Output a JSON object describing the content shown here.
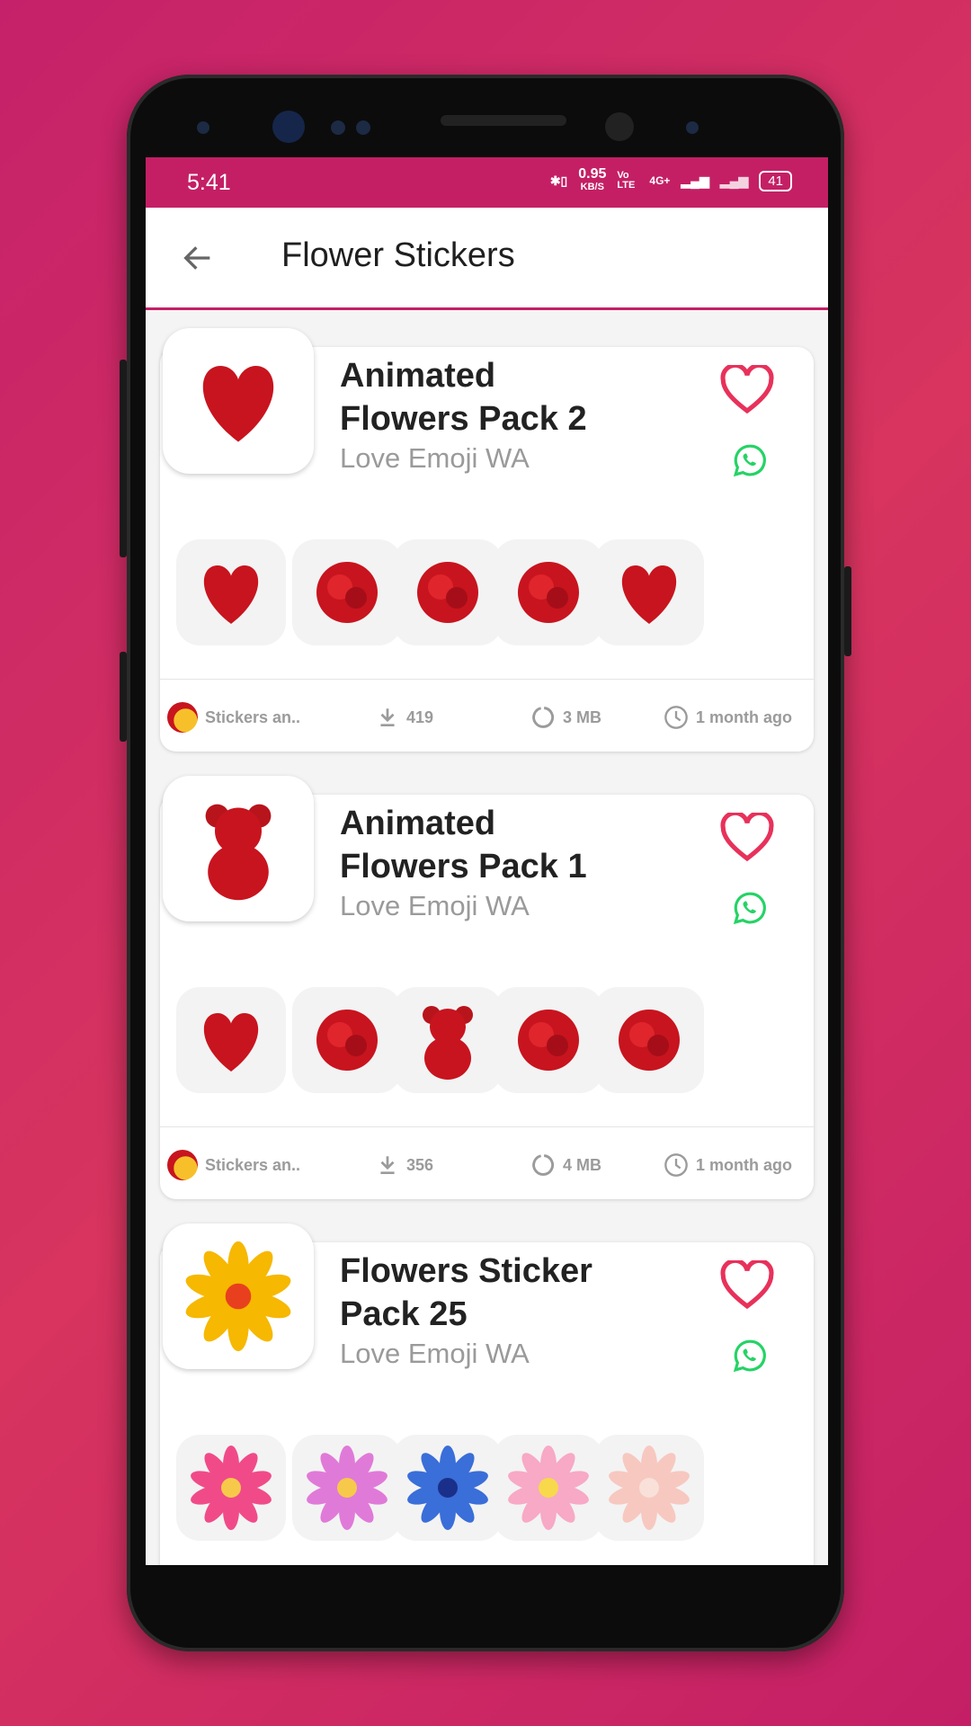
{
  "status_bar": {
    "time": "5:41",
    "net_speed": "0.95",
    "net_unit": "KB/S",
    "volte": "Vo LTE",
    "network": "4G+",
    "battery": "41"
  },
  "app_bar": {
    "title": "Flower Stickers",
    "back_icon": "arrow-left-icon"
  },
  "colors": {
    "accent": "#c41f65",
    "heart": "#e8315b",
    "whatsapp": "#25d366",
    "muted": "#9b9b9b"
  },
  "packs": [
    {
      "title": "Animated Flowers Pack 2",
      "author": "Love Emoji WA",
      "tray": "hearts-couple",
      "stickers": [
        "rose-heart",
        "red-rose",
        "four-roses",
        "single-rose",
        "jetaime-heart"
      ],
      "publisher": "Stickers an..",
      "downloads": "419",
      "size": "3 MB",
      "updated": "1 month ago"
    },
    {
      "title": "Animated Flowers Pack 1",
      "author": "Love Emoji WA",
      "tray": "rose-bear",
      "stickers": [
        "petal-heart",
        "rose-bouquet",
        "rose-bear",
        "mixed-bouquet",
        "red-roses"
      ],
      "publisher": "Stickers an..",
      "downloads": "356",
      "size": "4 MB",
      "updated": "1 month ago"
    },
    {
      "title": "Flowers Sticker Pack 25",
      "author": "Love Emoji WA",
      "tray": "yellow-flower",
      "stickers": [
        "pink-dahlia",
        "pink-daisy",
        "blue-flower",
        "plumeria",
        "pale-lotus"
      ],
      "publisher": "",
      "downloads": "",
      "size": "",
      "updated": ""
    }
  ]
}
